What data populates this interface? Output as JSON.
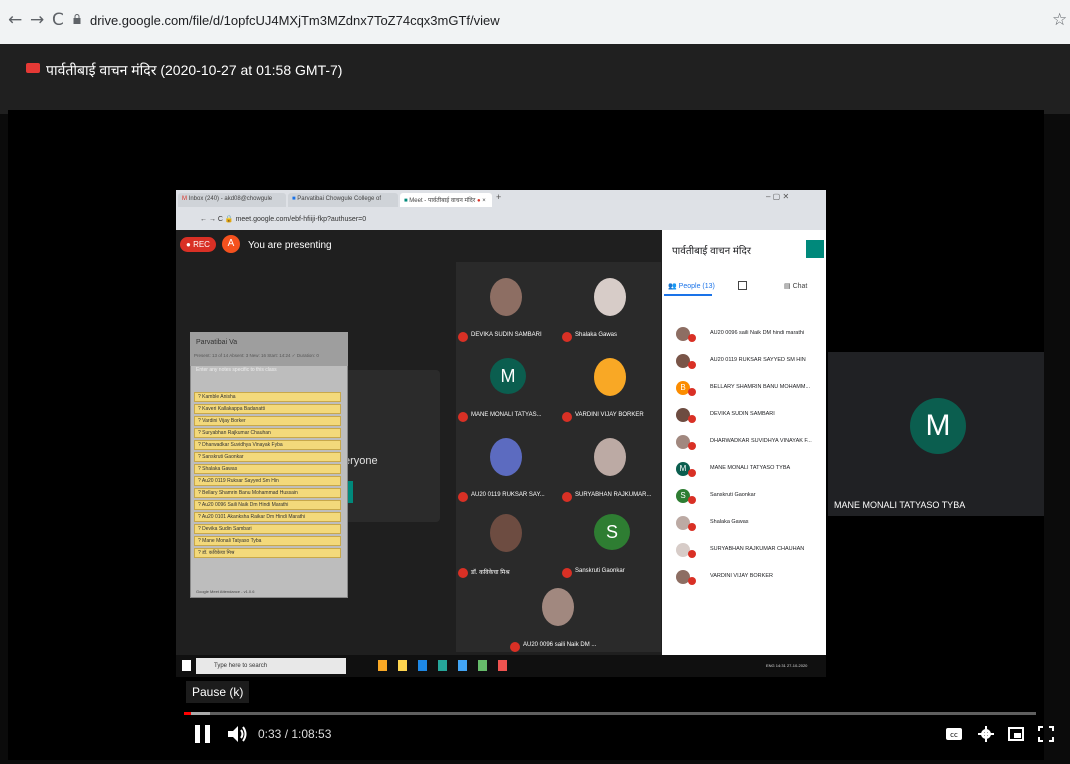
{
  "browser": {
    "url": "drive.google.com/file/d/1opfcUJ4MXjTm3MZdnx7ToZ74cqx3mGTf/view"
  },
  "viewer": {
    "title": "पार्वतीबाई वाचन मंदिर (2020-10-27 at 01:58 GMT-7)"
  },
  "inner": {
    "tabs": [
      "Inbox (240) - akd08@chowgule",
      "Parvatibai Chowgule College of",
      "Meet - पार्वतीबाई वाचन मंदिर"
    ],
    "url": "meet.google.com/ebf-hfiiji-fkp?authuser=0",
    "rec": "REC",
    "presenter_initial": "A",
    "presenting": "You are presenting",
    "dialog_fragment": "eryone",
    "tiles": [
      {
        "name": "DEVIKA SUDIN SAMBARI",
        "initial": ""
      },
      {
        "name": "Shalaka Gawas",
        "initial": ""
      },
      {
        "name": "MANE MONALI TATYAS...",
        "initial": "M"
      },
      {
        "name": "VARDINI VIJAY BORKER",
        "initial": ""
      },
      {
        "name": "AU20 0119 RUKSAR SAY...",
        "initial": ""
      },
      {
        "name": "SURYABHAN RAJKUMAR...",
        "initial": ""
      },
      {
        "name": "डॉ. कविकेचा मिश्र",
        "initial": ""
      },
      {
        "name": "Sanskruti Gaonkar",
        "initial": "S"
      },
      {
        "name": "AU20 0096 saili Naik DM ...",
        "initial": ""
      }
    ],
    "panel": {
      "title": "पार्वतीबाई वाचन मंदिर",
      "people_tab": "People (13)",
      "chat_tab": "Chat",
      "list": [
        {
          "name": "AU20 0096 saili Naik DM hindi marathi",
          "initial": ""
        },
        {
          "name": "AU20 0119 RUKSAR SAYYED SM HIN",
          "initial": ""
        },
        {
          "name": "BELLARY SHAMRIN BANU MOHAMM...",
          "initial": "B"
        },
        {
          "name": "DEVIKA SUDIN SAMBARI",
          "initial": ""
        },
        {
          "name": "DHARWADKAR SUVIDHYA VINAYAK F...",
          "initial": ""
        },
        {
          "name": "MANE MONALI TATYASO TYBA",
          "initial": "M"
        },
        {
          "name": "Sanskruti Gaonkar",
          "initial": "S"
        },
        {
          "name": "Shalaka Gawas",
          "initial": ""
        },
        {
          "name": "SURYABHAN RAJKUMAR CHAUHAN",
          "initial": ""
        },
        {
          "name": "VARDINI VIJAY BORKER",
          "initial": ""
        }
      ]
    },
    "attendance": {
      "title": "Parvatibai Va",
      "stats": "Present: 13 of 14   Absent: 3   New: 16   Start: 14:24  ✓ Duration: 0",
      "notes_placeholder": "Enter any notes specific to this class",
      "items": [
        "? Kamble Anisha",
        "? Kaveri Kallakappa Badanatti",
        "? Vardini Vijay Borker",
        "? Suryabhan Rajkumar Chauhan",
        "? Dharwadkar Suvidhya Vinayak Fyba",
        "? Sanskruti Gaonkar",
        "? Shalaka Gawas",
        "? Au20 0119 Ruksar Sayyed Sm Hin",
        "? Bellary Shamrin Banu Mohammad Hussain",
        "? Au20 0096 Saili Naik Dm Hindi Marathi",
        "? Au20 0101 Akanksha Raikar Dm Hindi Marathi",
        "? Devika Sudin Sambari",
        "? Mane Monali Tatyaso Tyba",
        "? डॉ. कविकेचा मिश्र"
      ],
      "footer": "Google Meet Attendance - v1.0.6"
    },
    "taskbar": {
      "search": "Type here to search",
      "tray": "ENG",
      "time": "14:31",
      "date": "27-10-2020"
    }
  },
  "right_tile": {
    "initial": "M",
    "name": "MANE MONALI TATYASO TYBA"
  },
  "player": {
    "tooltip": "Pause (k)",
    "time": "0:33 / 1:08:53",
    "played_fraction": 0.008,
    "buffered_fraction": 0.03
  },
  "colors": {
    "accent": "#1a73e8",
    "meet_teal": "#00897b",
    "rec": "#d93025",
    "progress": "#ff0000",
    "sticky": "#f3d97b"
  }
}
